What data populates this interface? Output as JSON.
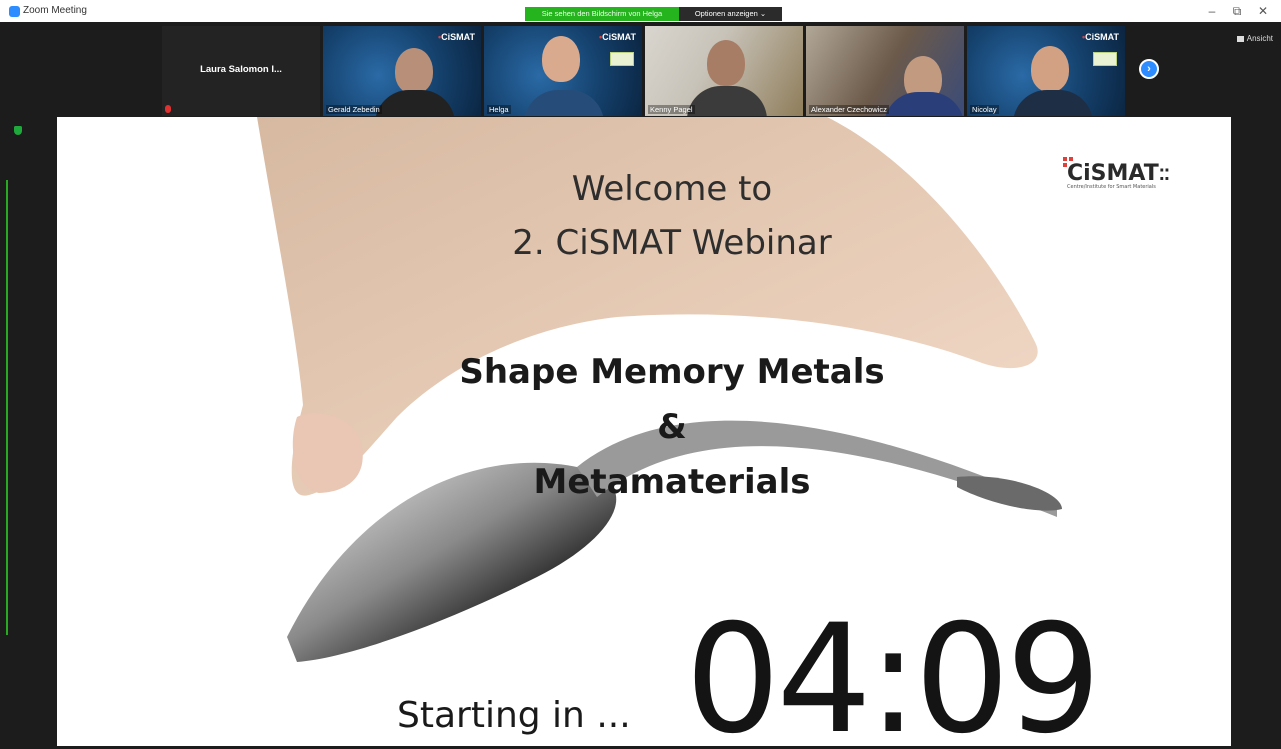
{
  "window": {
    "title": "Zoom Meeting"
  },
  "share_banner": {
    "text": "Sie sehen den Bildschirm von Helga",
    "options_label": "Optionen anzeigen ⌄"
  },
  "controls": {
    "minimize": "–",
    "restore": "⧉",
    "close": "✕",
    "view_label": "Ansicht"
  },
  "participants": [
    {
      "name": "Laura Salomon I..."
    },
    {
      "name": "Gerald Zebedin"
    },
    {
      "name": "Helga"
    },
    {
      "name": "Kenny Pagel"
    },
    {
      "name": "Alexander Czechowicz"
    },
    {
      "name": "Nicolay"
    }
  ],
  "tile_logo": "CiSMAT",
  "slide": {
    "welcome_line1": "Welcome to",
    "welcome_line2": "2. CiSMAT Webinar",
    "title_line1": "Shape Memory Metals",
    "title_line2": "&",
    "title_line3": "Metamaterials",
    "logo_text": "CiSMAT",
    "logo_sub": "Centre/Institute for Smart Materials",
    "starting": "Starting in ...",
    "countdown": "04:09"
  },
  "colors": {
    "share_green": "#25b31e",
    "zoom_blue": "#2d8cff"
  }
}
